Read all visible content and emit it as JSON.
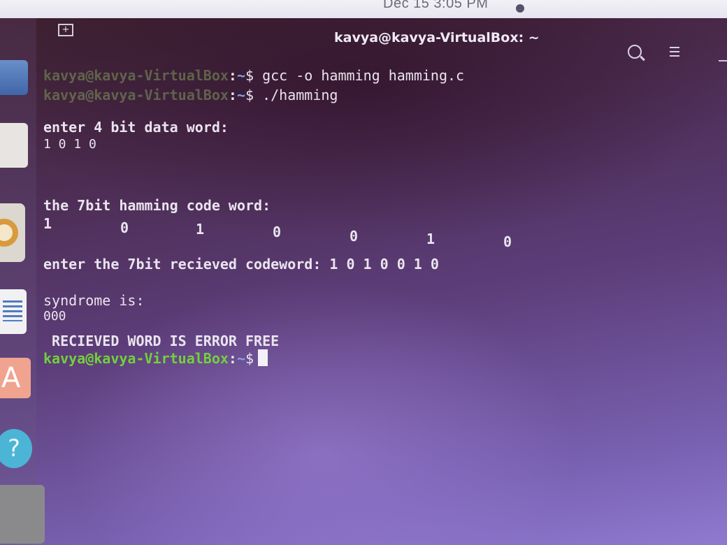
{
  "topbar": {
    "clock": "Dec 15   3:05 PM"
  },
  "window": {
    "title": "kavya@kavya-VirtualBox: ~"
  },
  "launcher": {
    "help_glyph": "?",
    "font_glyph": "A"
  },
  "terminal": {
    "prompt_user": "kavya@kavya-VirtualBox",
    "prompt_sep": ":",
    "prompt_path": "~",
    "prompt_symbol": "$",
    "cmd1": " gcc -o hamming hamming.c",
    "cmd2": " ./hamming",
    "line_enter_data": "enter 4 bit data word:",
    "data_word": "1 0 1 0",
    "line_codeword_title": "the 7bit hamming code word:",
    "codeword_bits": [
      "1",
      "0",
      "1",
      "0",
      "0",
      "1",
      "0"
    ],
    "line_received": "enter the 7bit recieved codeword: 1 0 1 0 0 1 0",
    "line_syndrome": "syndrome is:",
    "syndrome_value": "000",
    "line_result": " RECIEVED WORD IS ERROR FREE"
  }
}
